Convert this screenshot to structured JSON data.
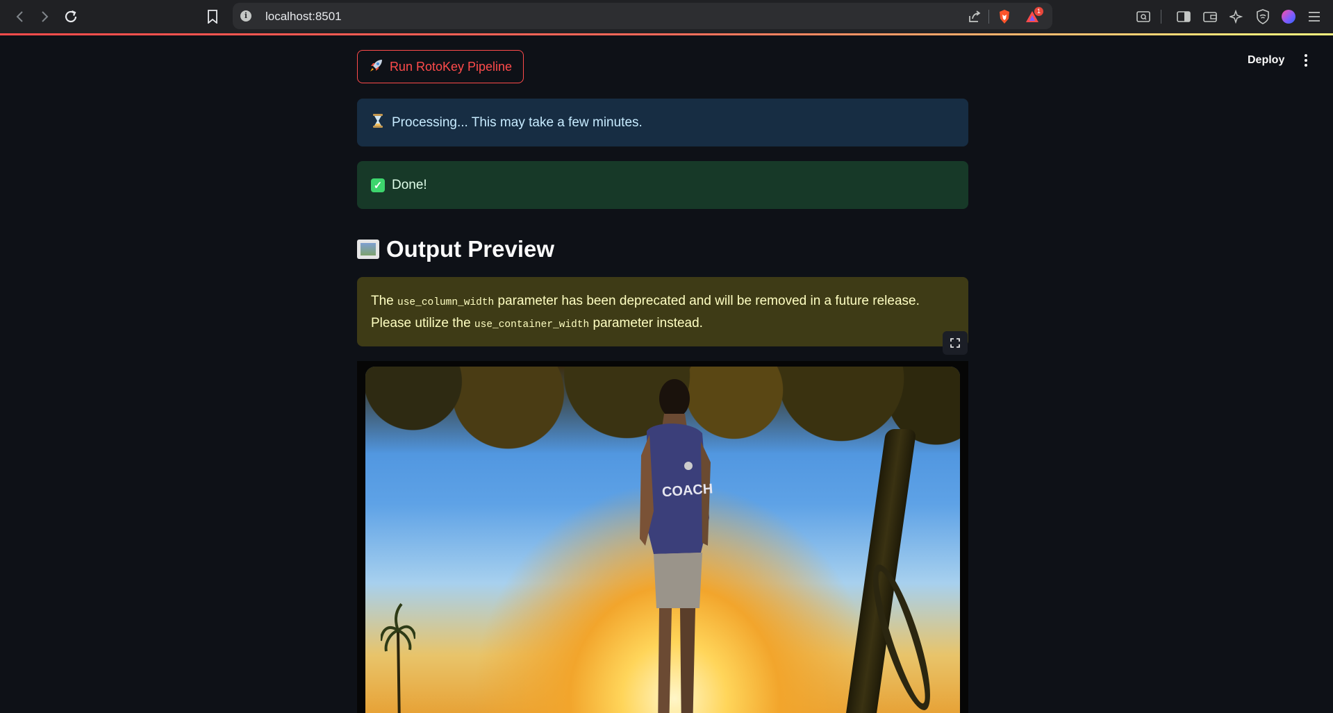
{
  "browser": {
    "url": "localhost:8501",
    "notification_count": "1"
  },
  "header": {
    "deploy_label": "Deploy"
  },
  "main": {
    "run_button_label": "Run RotoKey Pipeline",
    "run_button_icon": "rocket-icon",
    "info_alert": {
      "icon": "hourglass-icon",
      "text": "Processing... This may take a few minutes."
    },
    "success_alert": {
      "icon": "check-mark-icon",
      "text": "Done!"
    },
    "section_heading": {
      "icon": "framed-picture-icon",
      "text": "Output Preview"
    },
    "warning_alert": {
      "text_1": "The ",
      "code_1": "use_column_width",
      "text_2": " parameter has been deprecated and will be removed in a future release. Please utilize the ",
      "code_2": "use_container_width",
      "text_3": " parameter instead."
    },
    "preview_image": {
      "subject": "person in jersey labeled COACH walking under trees at sunset",
      "jersey_text": "COACH"
    }
  },
  "colors": {
    "app_background": "#0e1117",
    "accent": "#ff4b4b",
    "info_bg": "#172d43",
    "success_bg": "#173928",
    "warning_bg": "#3e3b16"
  }
}
